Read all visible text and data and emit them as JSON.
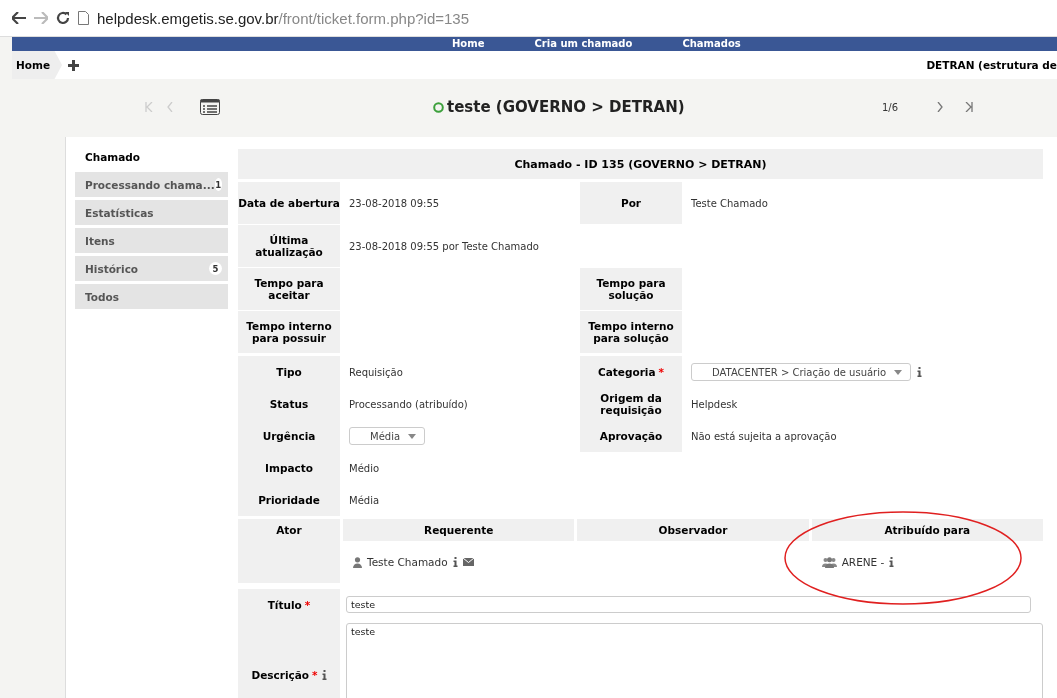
{
  "browser": {
    "url_host": "helpdesk.emgetis.se.gov.br",
    "url_path": "/front/ticket.form.php?id=135"
  },
  "nav_items": [
    "Home",
    "Cria um chamado",
    "Chamados"
  ],
  "breadcrumb": {
    "home": "Home",
    "entity": "DETRAN (estrutura de"
  },
  "ticket_header": {
    "title": "teste (GOVERNO > DETRAN)",
    "counter": "1/6"
  },
  "sidebar": {
    "heading": "Chamado",
    "items": [
      {
        "label": "Processando chama...",
        "count": "1"
      },
      {
        "label": "Estatísticas"
      },
      {
        "label": "Itens"
      },
      {
        "label": "Histórico",
        "count": "5"
      },
      {
        "label": "Todos"
      }
    ]
  },
  "form": {
    "title": "Chamado - ID 135 (GOVERNO > DETRAN)",
    "sections": [
      {
        "kind": "dates",
        "rows": [
          {
            "left": {
              "label": "Data de abertura",
              "value": "23-08-2018 09:55"
            },
            "right": {
              "label": "Por",
              "value": "Teste Chamado"
            }
          },
          {
            "left": {
              "label": "Última atualização",
              "value": "23-08-2018 09:55 por Teste Chamado"
            }
          },
          {
            "left": {
              "label": "Tempo para aceitar"
            },
            "right": {
              "label": "Tempo para solução"
            }
          },
          {
            "left": {
              "label": "Tempo interno para possuir"
            },
            "right": {
              "label": "Tempo interno para solução"
            }
          }
        ]
      },
      {
        "kind": "fields",
        "rows": [
          {
            "left": {
              "label": "Tipo",
              "value": "Requisição"
            },
            "right": {
              "label": "Categoria",
              "required_mark": "*",
              "kind": "select",
              "value": "DATACENTER > Criação de usuário",
              "info": true
            }
          },
          {
            "left": {
              "label": "Status",
              "value": "Processando (atribuído)"
            },
            "right": {
              "label": "Origem da requisição",
              "value": "Helpdesk"
            }
          },
          {
            "left": {
              "label": "Urgência",
              "kind": "select",
              "value": "Média"
            },
            "right": {
              "label": "Aprovação",
              "value": "Não está sujeita a aprovação"
            }
          },
          {
            "left": {
              "label": "Impacto",
              "value": "Médio"
            }
          },
          {
            "left": {
              "label": "Prioridade",
              "value": "Média"
            }
          }
        ]
      }
    ],
    "actors": {
      "label": "Ator",
      "columns": [
        {
          "heading": "Requerente",
          "entries": [
            {
              "kind": "user",
              "name": "Teste Chamado",
              "info": true,
              "email": true
            }
          ]
        },
        {
          "heading": "Observador"
        },
        {
          "heading": "Atribuído para",
          "entries": [
            {
              "kind": "group",
              "name": "ARENE -",
              "info": true
            }
          ]
        }
      ]
    },
    "title_field": {
      "label": "Título",
      "required_mark": "*",
      "value": "teste"
    },
    "description_field": {
      "label": "Descrição",
      "required_mark": "*",
      "info": true,
      "value": "teste"
    }
  }
}
